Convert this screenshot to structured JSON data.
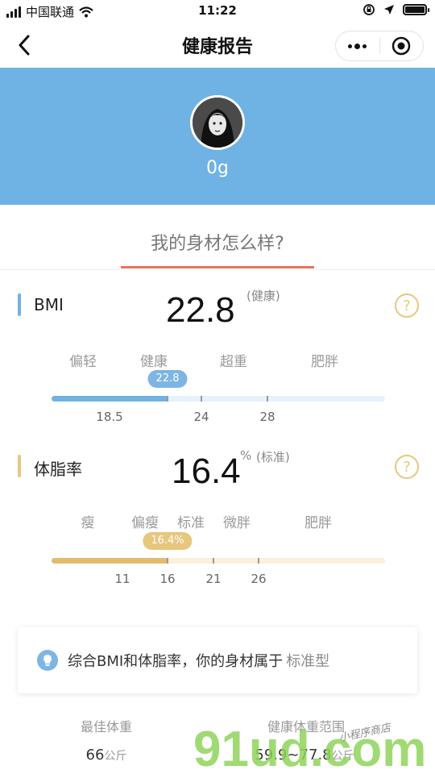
{
  "status_bar": {
    "carrier": "中国联通",
    "time": "11:22"
  },
  "nav": {
    "title": "健康报告"
  },
  "profile": {
    "weight": "0g"
  },
  "section": {
    "question": "我的身材怎么样?"
  },
  "bmi": {
    "label": "BMI",
    "value": "22.8",
    "status": "(健康)",
    "help": "?",
    "categories": [
      "偏轻",
      "健康",
      "超重",
      "肥胖"
    ],
    "bubble": "22.8",
    "ticks": [
      "18.5",
      "24",
      "28"
    ],
    "fill_fraction": 0.35,
    "colors": {
      "marker": "#6fb2e4",
      "fill": "#6fb2e4",
      "track": "#e6f1fb",
      "bubble": "#7db5e3"
    }
  },
  "body_fat": {
    "label": "体脂率",
    "value": "16.4",
    "unit": "%",
    "status": "(标准)",
    "help": "?",
    "categories": [
      "瘦",
      "偏瘦",
      "标准",
      "微胖",
      "肥胖"
    ],
    "bubble": "16.4%",
    "ticks": [
      "11",
      "16",
      "21",
      "26"
    ],
    "fill_fraction": 0.35,
    "colors": {
      "marker": "#e7c77e",
      "fill": "#e2bb6f",
      "track": "#fbf0dc",
      "bubble": "#e7c77e"
    }
  },
  "conclusion": {
    "text": "综合BMI和体脂率，你的身材属于",
    "type": "标准型"
  },
  "stats": {
    "best_weight_label": "最佳体重",
    "best_weight_value": "66",
    "best_weight_unit": "公斤",
    "range_label": "健康体重范围",
    "range_value": "59.9~77.8",
    "range_unit": "公斤"
  },
  "watermark": {
    "brand": "91ud.com",
    "sub": "小程序商店"
  }
}
